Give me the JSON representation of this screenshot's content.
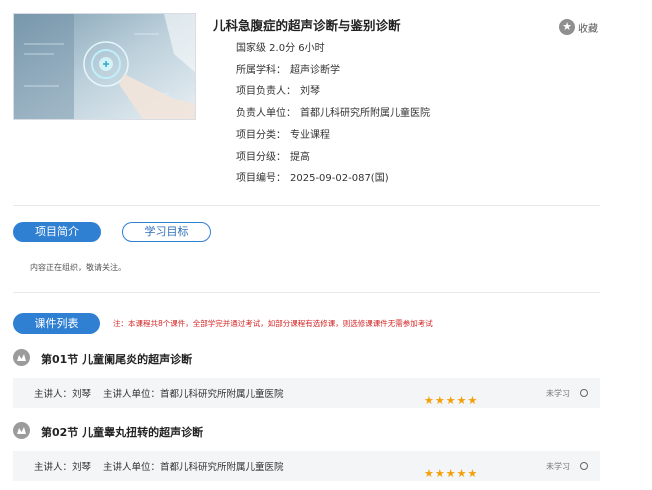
{
  "course": {
    "title": "儿科急腹症的超声诊断与鉴别诊断",
    "level_credit": "国家级 2.0分 6小时",
    "discipline_label": "所属学科：",
    "discipline": "超声诊断学",
    "leader_label": "项目负责人：",
    "leader": "刘琴",
    "unit_label": "负责人单位：",
    "unit": "首都儿科研究所附属儿童医院",
    "category_label": "项目分类：",
    "category": "专业课程",
    "grade_label": "项目分级：",
    "grade": "提高",
    "code_label": "项目编号：",
    "code": "2025-09-02-087(国)"
  },
  "favorite": {
    "label": "收藏",
    "icon": "star-icon"
  },
  "tabs": [
    {
      "label": "项目简介",
      "active": true
    },
    {
      "label": "学习目标",
      "active": false
    }
  ],
  "intro": {
    "text": "内容正在组织，敬请关注。"
  },
  "courses": {
    "tab_label": "课件列表",
    "note": "注：本课程共8个课件，全部学完并通过考试，如部分课程有选修课，则选修课课件无需参加考试",
    "items": [
      {
        "title": "第01节 儿童阑尾炎的超声诊断",
        "lecturer_label": "主讲人：",
        "lecturer": "刘琴",
        "unit_label": "主讲人单位：",
        "unit": "首都儿科研究所附属儿童医院",
        "status": "未学习",
        "rating": "★★★★★"
      },
      {
        "title": "第02节 儿童睾丸扭转的超声诊断",
        "lecturer_label": "主讲人：",
        "lecturer": "刘琴",
        "unit_label": "主讲人单位：",
        "unit": "首都儿科研究所附属儿童医院",
        "status": "未学习",
        "rating": "★★★★★"
      }
    ]
  },
  "colors": {
    "accent": "#2f7fd3",
    "note": "#d42424",
    "star": "#f2a007"
  }
}
